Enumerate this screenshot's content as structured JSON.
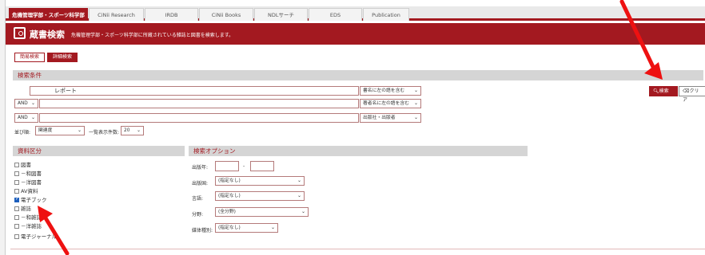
{
  "tabs": [
    {
      "label": "危機管理学部・スポーツ科学部"
    },
    {
      "label": "CiNii Research"
    },
    {
      "label": "IRDB"
    },
    {
      "label": "CiNii Books"
    },
    {
      "label": "NDLサーチ"
    },
    {
      "label": "EDS"
    },
    {
      "label": "Publication Finder"
    }
  ],
  "header": {
    "title": "蔵書検索",
    "subtitle": "危機管理学部・スポーツ科学部に所蔵されている雑誌と図書を検索します。"
  },
  "modes": {
    "simple": "簡易検索",
    "advanced": "詳細検索"
  },
  "conditions": {
    "title": "検索条件",
    "row1_value": "レポート",
    "row1_field": "書名に左の語を含む",
    "row2_op": "AND",
    "row2_field": "著者名に左の語を含む",
    "row3_op": "AND",
    "row3_field": "出版社・出版者",
    "sort_label": "並び順:",
    "sort_value": "関連度",
    "count_label": "一覧表示件数:",
    "count_value": "20",
    "search_button": "検索",
    "clear_button": "クリア"
  },
  "material": {
    "title": "資料区分",
    "items": [
      {
        "label": "図書",
        "checked": false
      },
      {
        "label": "－和図書",
        "checked": false
      },
      {
        "label": "－洋図書",
        "checked": false
      },
      {
        "label": "AV資料",
        "checked": false
      },
      {
        "label": "電子ブック",
        "checked": true
      },
      {
        "label": "雑誌",
        "checked": false
      },
      {
        "label": "－和雑誌",
        "checked": false
      },
      {
        "label": "－洋雑誌",
        "checked": false
      },
      {
        "label": "電子ジャーナル",
        "checked": false
      }
    ]
  },
  "options": {
    "title": "検索オプション",
    "year_label": "出版年:",
    "year_sep": "-",
    "country_label": "出版国:",
    "country_value": "(指定なし)",
    "language_label": "言語:",
    "language_value": "(指定なし)",
    "field_label": "分野:",
    "field_value": "(全分野)",
    "media_label": "媒体種別:",
    "media_value": "(指定なし)"
  },
  "colors": {
    "brand": "#a31920",
    "arrow": "#ee1111",
    "checkbox": "#1d5fbd"
  }
}
